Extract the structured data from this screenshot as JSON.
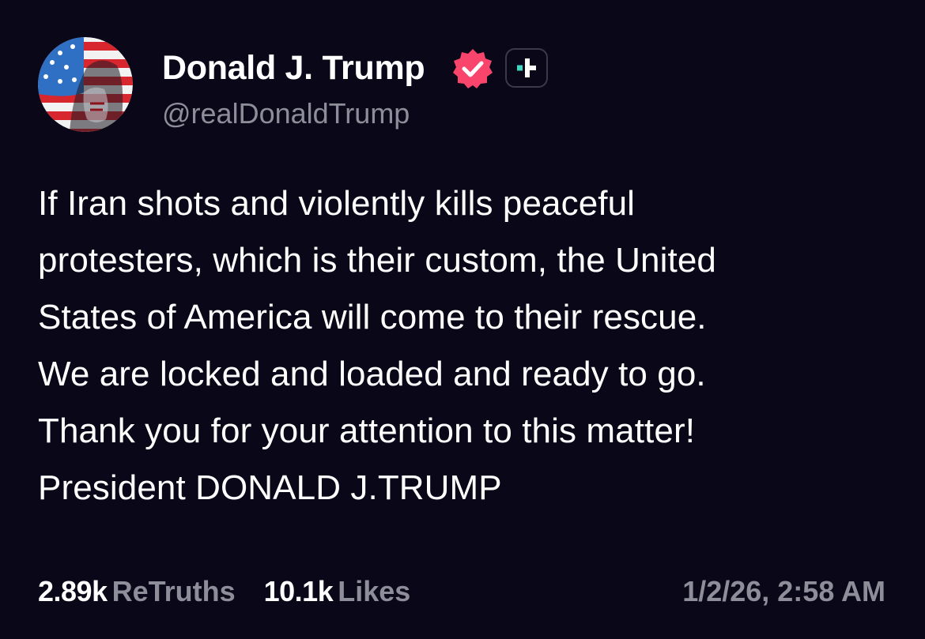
{
  "author": {
    "display_name": "Donald J. Trump",
    "handle": "@realDonaldTrump",
    "verified_badge_color": "#f9446b",
    "plus_badge_accent": "#3fd9c3"
  },
  "post": {
    "lines": [
      "If Iran shots and violently kills peaceful",
      "protesters, which is their custom, the United",
      "States of America will come to their rescue.",
      "We are locked and loaded and ready to go.",
      "Thank you for your attention to this matter!",
      "President DONALD J.TRUMP"
    ]
  },
  "stats": {
    "retruths_count": "2.89k",
    "retruths_label": "ReTruths",
    "likes_count": "10.1k",
    "likes_label": "Likes"
  },
  "timestamp": "1/2/26, 2:58 AM",
  "colors": {
    "background": "#0a0818",
    "primary_text": "#ffffff",
    "secondary_text": "#8e8e9a"
  }
}
